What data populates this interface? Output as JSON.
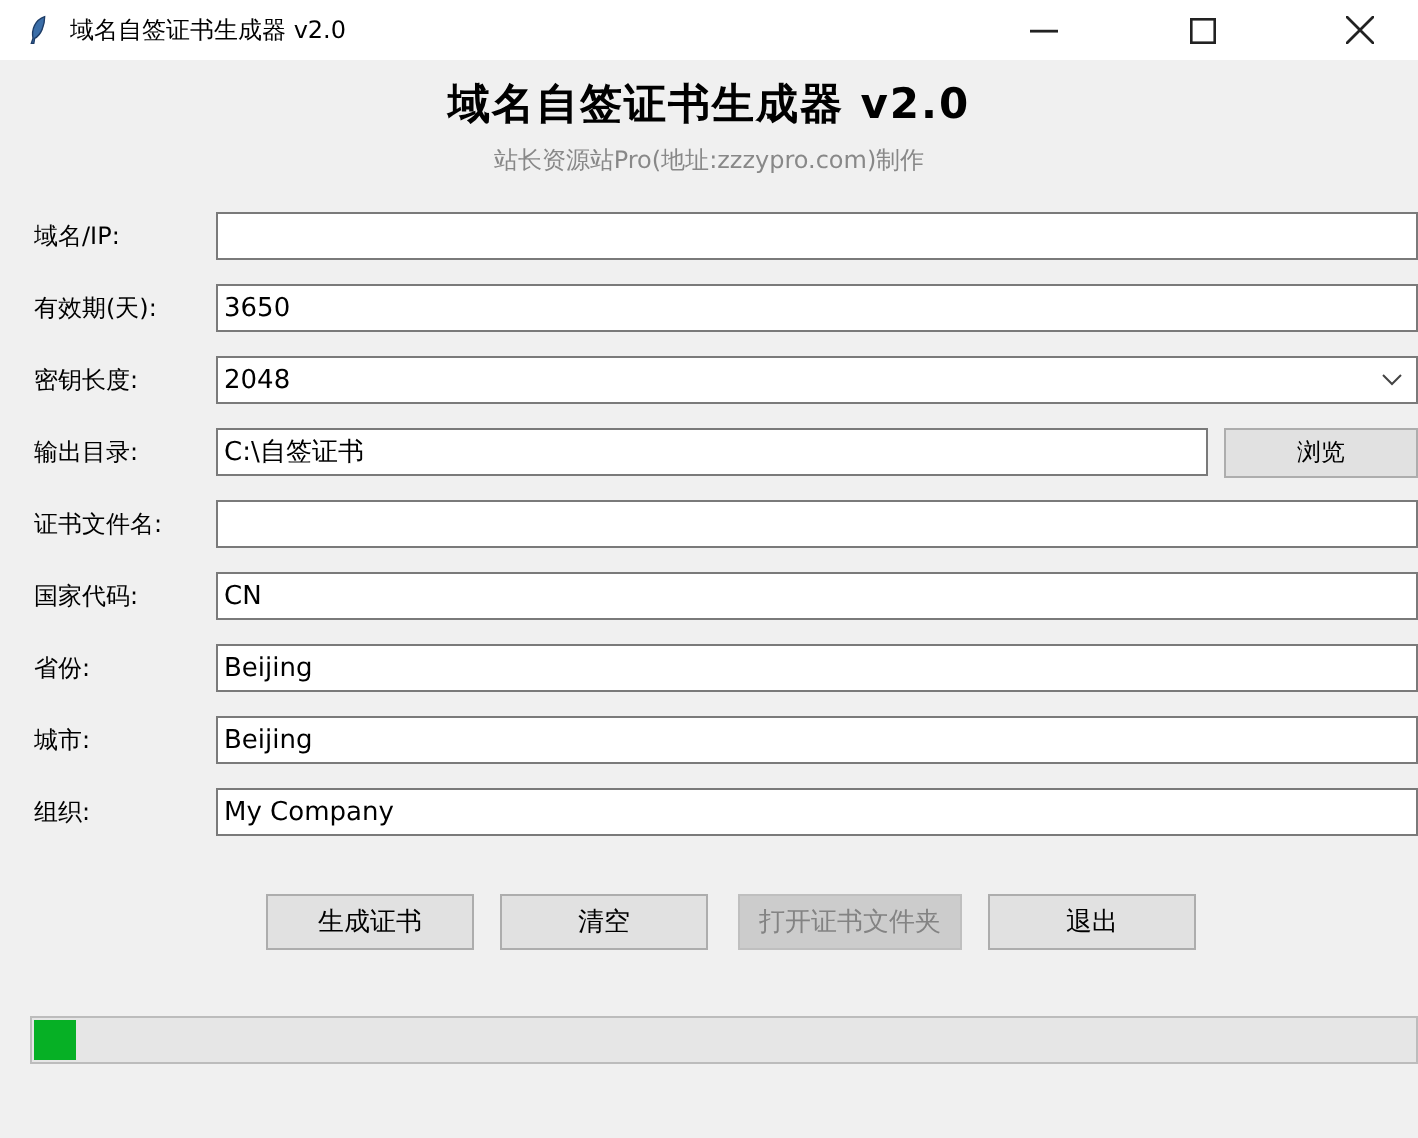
{
  "window": {
    "title": "域名自签证书生成器 v2.0"
  },
  "heading": "域名自签证书生成器 v2.0",
  "subtitle": "站长资源站Pro(地址:zzzypro.com)制作",
  "fields": [
    {
      "kind": "entry",
      "label": "域名/IP:"
    },
    {
      "kind": "entry",
      "label": "有效期(天):",
      "value": "3650"
    },
    {
      "kind": "combo",
      "label": "密钥长度:",
      "value": "2048"
    },
    {
      "kind": "browse",
      "label": "输出目录:",
      "value": "C:\\自签证书",
      "button": "浏览"
    },
    {
      "kind": "entry",
      "label": "证书文件名:"
    },
    {
      "kind": "entry",
      "label": "国家代码:",
      "value": "CN"
    },
    {
      "kind": "entry",
      "label": "省份:",
      "value": "Beijing"
    },
    {
      "kind": "entry",
      "label": "城市:",
      "value": "Beijing"
    },
    {
      "kind": "entry",
      "label": "组织:",
      "value": "My Company"
    }
  ],
  "buttons": [
    {
      "label": "生成证书",
      "disabled": false
    },
    {
      "label": "清空",
      "disabled": false
    },
    {
      "label": "打开证书文件夹",
      "disabled": true
    },
    {
      "label": "退出",
      "disabled": false
    }
  ],
  "progress": {
    "level": 0.03
  }
}
